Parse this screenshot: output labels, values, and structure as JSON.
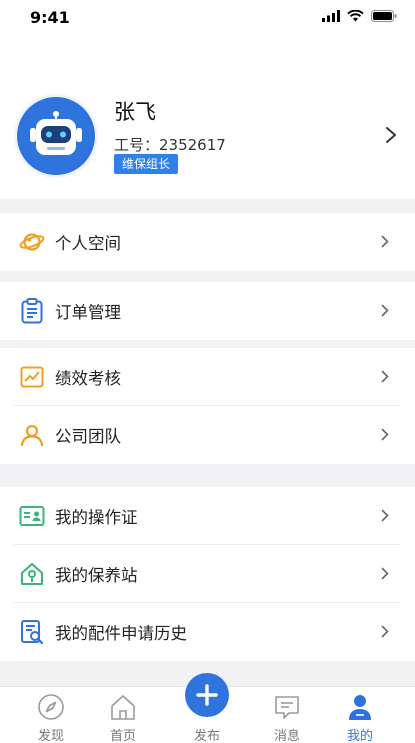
{
  "status_bar": {
    "time": "9:41"
  },
  "profile": {
    "name": "张飞",
    "employee_id": "工号：2352617",
    "role": "维保组长"
  },
  "menu": {
    "group1": [
      {
        "label": "个人空间",
        "icon": "planet-icon"
      }
    ],
    "group2": [
      {
        "label": "订单管理",
        "icon": "clipboard-icon"
      }
    ],
    "group3": [
      {
        "label": "绩效考核",
        "icon": "chart-icon"
      },
      {
        "label": "公司团队",
        "icon": "team-icon"
      }
    ],
    "group4": [
      {
        "label": "我的操作证",
        "icon": "id-card-icon"
      },
      {
        "label": "我的保养站",
        "icon": "house-icon"
      },
      {
        "label": "我的配件申请历史",
        "icon": "document-search-icon"
      }
    ]
  },
  "tabbar": {
    "discover": "发现",
    "home": "首页",
    "publish": "发布",
    "messages": "消息",
    "mine": "我的",
    "active_color": "#2f74dd"
  },
  "colors": {
    "accent": "#2f74dd",
    "orange": "#f0a020",
    "green": "#3db37a"
  }
}
